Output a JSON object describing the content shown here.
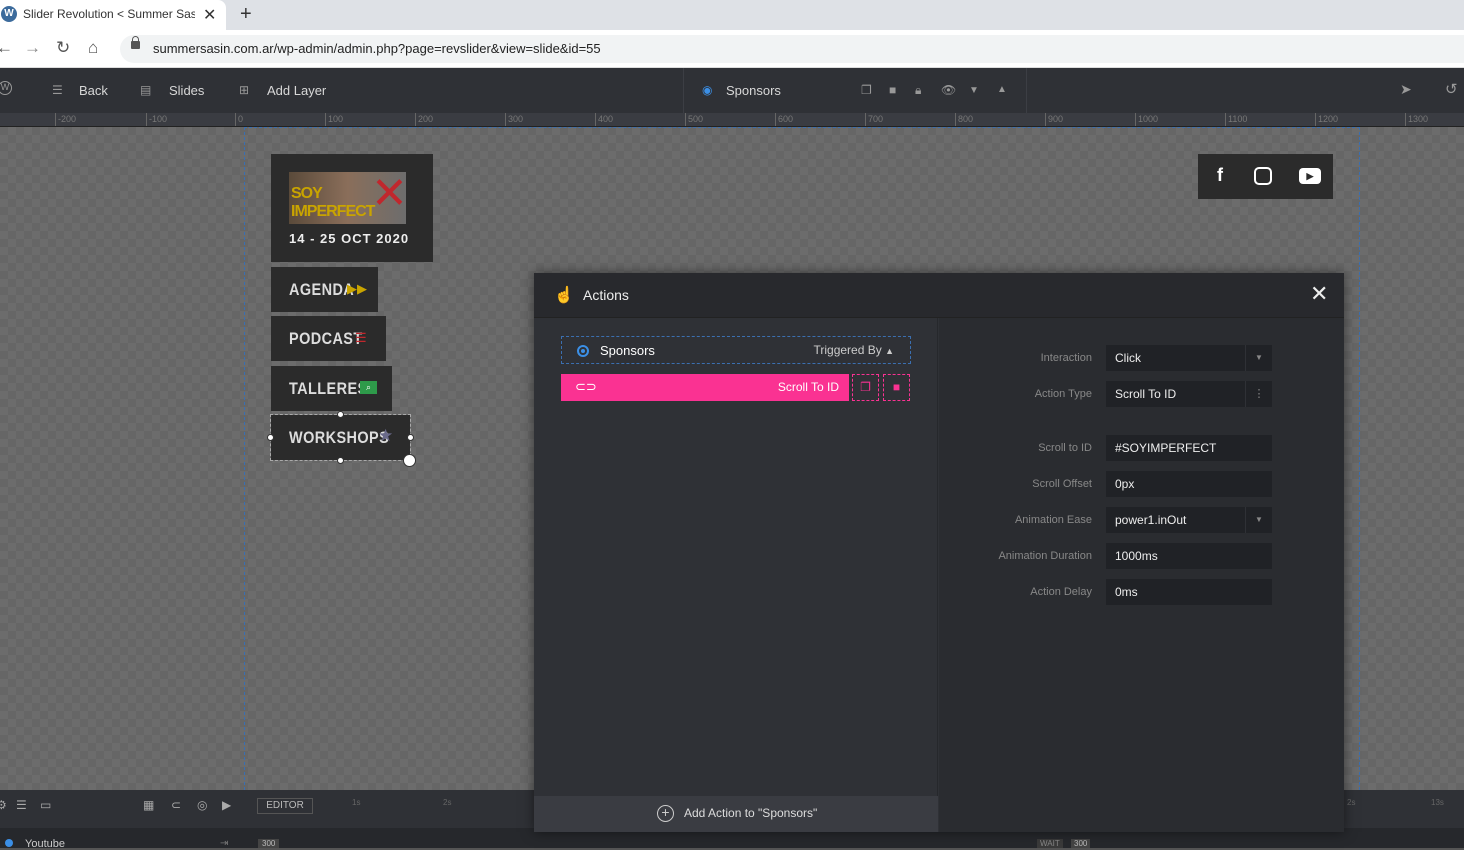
{
  "browser": {
    "tab_title": "Slider Revolution < Summer Sasin",
    "tab_close": "✕",
    "new_tab": "+",
    "url": "summersasin.com.ar/wp-admin/admin.php?page=revslider&view=slide&id=55"
  },
  "toolbar": {
    "back_label": "Back",
    "slides_label": "Slides",
    "add_layer_label": "Add Layer",
    "selected_layer_label": "Sponsors"
  },
  "ruler": {
    "ticks": [
      "-200",
      "-100",
      "0",
      "100",
      "200",
      "300",
      "400",
      "500",
      "600",
      "700",
      "800",
      "900",
      "1000",
      "1100",
      "1200",
      "1300"
    ]
  },
  "canvas": {
    "event_date": "14 - 25 OCT 2020",
    "event_image_text": "SOY IMPERFECT",
    "menu": [
      {
        "label": "AGENDA",
        "icon": "fast-forward-icon",
        "color": "#c9a400"
      },
      {
        "label": "PODCAST",
        "icon": "list-icon",
        "color": "#c0272d"
      },
      {
        "label": "TALLERES",
        "icon": "search-icon",
        "color": "#2e9a4a"
      },
      {
        "label": "WORKSHOPS",
        "icon": "star-icon",
        "color": "#6a6a8a"
      }
    ],
    "social": [
      "facebook-icon",
      "instagram-icon",
      "youtube-icon"
    ]
  },
  "timeline": {
    "editor_label": "EDITOR",
    "layer_name": "Youtube",
    "value_300": "300",
    "wait_label": "WAIT",
    "wait_value": "300",
    "time_1s": "1s",
    "time_2s": "2s",
    "time_12s": "2s",
    "time_13s": "13s"
  },
  "modal": {
    "title": "Actions",
    "layer_name": "Sponsors",
    "triggered_by": "Triggered By",
    "action_name": "Scroll To ID",
    "add_action": "Add Action to \"Sponsors\"",
    "fields": {
      "interaction_label": "Interaction",
      "interaction_value": "Click",
      "action_type_label": "Action Type",
      "action_type_value": "Scroll To ID",
      "scroll_to_id_label": "Scroll to ID",
      "scroll_to_id_value": "#SOYIMPERFECT",
      "scroll_offset_label": "Scroll Offset",
      "scroll_offset_value": "0px",
      "animation_ease_label": "Animation Ease",
      "animation_ease_value": "power1.inOut",
      "animation_duration_label": "Animation Duration",
      "animation_duration_value": "1000ms",
      "action_delay_label": "Action Delay",
      "action_delay_value": "0ms"
    }
  },
  "colors": {
    "accent_pink": "#fa3292",
    "accent_blue": "#3b8fe6"
  }
}
